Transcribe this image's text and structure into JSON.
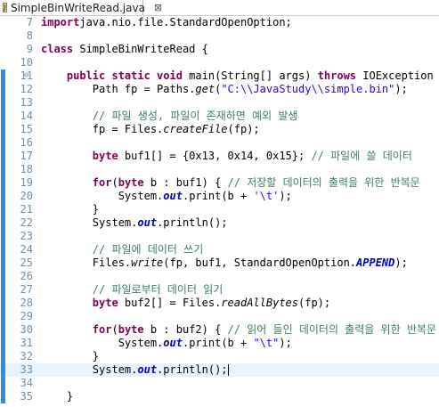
{
  "tab": {
    "icon": "java-file-icon",
    "icon_letter": "J",
    "title": "SimpleBinWriteRead.java",
    "close_glyph": "⊠"
  },
  "colors": {
    "keyword": "#7f0055",
    "string": "#2a00ff",
    "comment": "#3f7f5f",
    "field": "#0000c0",
    "line_number": "#6e8fa8",
    "current_line": "#e8f2fe",
    "change_marker": "#3a88d8"
  },
  "code": {
    "lines": [
      {
        "num": "7",
        "tokens": [
          [
            "kw",
            "import"
          ],
          [
            "",
            "java.nio.file.StandardOpenOption;"
          ]
        ]
      },
      {
        "num": "8",
        "tokens": []
      },
      {
        "num": "9",
        "tokens": [
          [
            "kw",
            "class"
          ],
          [
            "",
            " SimpleBinWriteRead {"
          ]
        ]
      },
      {
        "num": "10",
        "tokens": []
      },
      {
        "num": "11",
        "fold": "⊖",
        "marker": true,
        "tokens": [
          [
            "",
            "    "
          ],
          [
            "kw",
            "public static void"
          ],
          [
            "",
            " main(String[] args) "
          ],
          [
            "kw",
            "throws"
          ],
          [
            "",
            " IOException {"
          ]
        ]
      },
      {
        "num": "12",
        "marker": true,
        "tokens": [
          [
            "",
            "        Path fp = Paths."
          ],
          [
            "it",
            "get"
          ],
          [
            "",
            "("
          ],
          [
            "str",
            "\"C:\\\\JavaStudy\\\\simple.bin\""
          ],
          [
            "",
            ");"
          ]
        ]
      },
      {
        "num": "13",
        "marker": true,
        "tokens": []
      },
      {
        "num": "14",
        "marker": true,
        "tokens": [
          [
            "",
            "        "
          ],
          [
            "cm",
            "// 파일 생성, 파일이 존재하면 예외 발생"
          ]
        ]
      },
      {
        "num": "15",
        "marker": true,
        "tokens": [
          [
            "",
            "        fp = Files."
          ],
          [
            "it",
            "createFile"
          ],
          [
            "",
            "(fp);"
          ]
        ]
      },
      {
        "num": "16",
        "marker": true,
        "tokens": []
      },
      {
        "num": "17",
        "marker": true,
        "tokens": [
          [
            "",
            "        "
          ],
          [
            "kw",
            "byte"
          ],
          [
            "",
            " buf1[] = {0x13, 0x14, 0x15}; "
          ],
          [
            "cm",
            "// 파일에 쓸 데이터"
          ]
        ]
      },
      {
        "num": "18",
        "marker": true,
        "tokens": []
      },
      {
        "num": "19",
        "marker": true,
        "tokens": [
          [
            "",
            "        "
          ],
          [
            "kw",
            "for"
          ],
          [
            "",
            "("
          ],
          [
            "kw",
            "byte"
          ],
          [
            "",
            " b : buf1) { "
          ],
          [
            "cm",
            "// 저장할 데이터의 출력을 위한 반복문"
          ]
        ]
      },
      {
        "num": "20",
        "marker": true,
        "tokens": [
          [
            "",
            "            System."
          ],
          [
            "fld",
            "out"
          ],
          [
            "",
            ".print(b + "
          ],
          [
            "str",
            "'\\t'"
          ],
          [
            "",
            ");"
          ]
        ]
      },
      {
        "num": "21",
        "marker": true,
        "tokens": [
          [
            "",
            "        }"
          ]
        ]
      },
      {
        "num": "22",
        "marker": true,
        "tokens": [
          [
            "",
            "        System."
          ],
          [
            "fld",
            "out"
          ],
          [
            "",
            ".println();"
          ]
        ]
      },
      {
        "num": "23",
        "marker": true,
        "tokens": []
      },
      {
        "num": "24",
        "marker": true,
        "tokens": [
          [
            "",
            "        "
          ],
          [
            "cm",
            "// 파일에 데이터 쓰기"
          ]
        ]
      },
      {
        "num": "25",
        "marker": true,
        "tokens": [
          [
            "",
            "        Files."
          ],
          [
            "it",
            "write"
          ],
          [
            "",
            "(fp, buf1, StandardOpenOption."
          ],
          [
            "fld",
            "APPEND"
          ],
          [
            "",
            ");"
          ]
        ]
      },
      {
        "num": "26",
        "marker": true,
        "tokens": []
      },
      {
        "num": "27",
        "marker": true,
        "tokens": [
          [
            "",
            "        "
          ],
          [
            "cm",
            "// 파일로부터 데이터 읽기"
          ]
        ]
      },
      {
        "num": "28",
        "marker": true,
        "tokens": [
          [
            "",
            "        "
          ],
          [
            "kw",
            "byte"
          ],
          [
            "",
            " buf2[] = Files."
          ],
          [
            "it",
            "readAllBytes"
          ],
          [
            "",
            "(fp);"
          ]
        ]
      },
      {
        "num": "29",
        "marker": true,
        "tokens": []
      },
      {
        "num": "30",
        "marker": true,
        "tokens": [
          [
            "",
            "        "
          ],
          [
            "kw",
            "for"
          ],
          [
            "",
            "("
          ],
          [
            "kw",
            "byte"
          ],
          [
            "",
            " b : buf2) { "
          ],
          [
            "cm",
            "// 읽어 들인 데이터의 출력을 위한 반복문"
          ]
        ]
      },
      {
        "num": "31",
        "marker": true,
        "tokens": [
          [
            "",
            "            System."
          ],
          [
            "fld",
            "out"
          ],
          [
            "",
            ".print(b + "
          ],
          [
            "str",
            "\"\\t\""
          ],
          [
            "",
            ");"
          ]
        ]
      },
      {
        "num": "32",
        "marker": true,
        "tokens": [
          [
            "",
            "        }"
          ]
        ]
      },
      {
        "num": "33",
        "marker": true,
        "current": true,
        "caret": true,
        "tokens": [
          [
            "",
            "        System."
          ],
          [
            "fld",
            "out"
          ],
          [
            "",
            ".println();"
          ]
        ]
      },
      {
        "num": "34",
        "marker": true,
        "tokens": []
      },
      {
        "num": "35",
        "marker": true,
        "tokens": [
          [
            "",
            "    }"
          ]
        ]
      }
    ]
  }
}
